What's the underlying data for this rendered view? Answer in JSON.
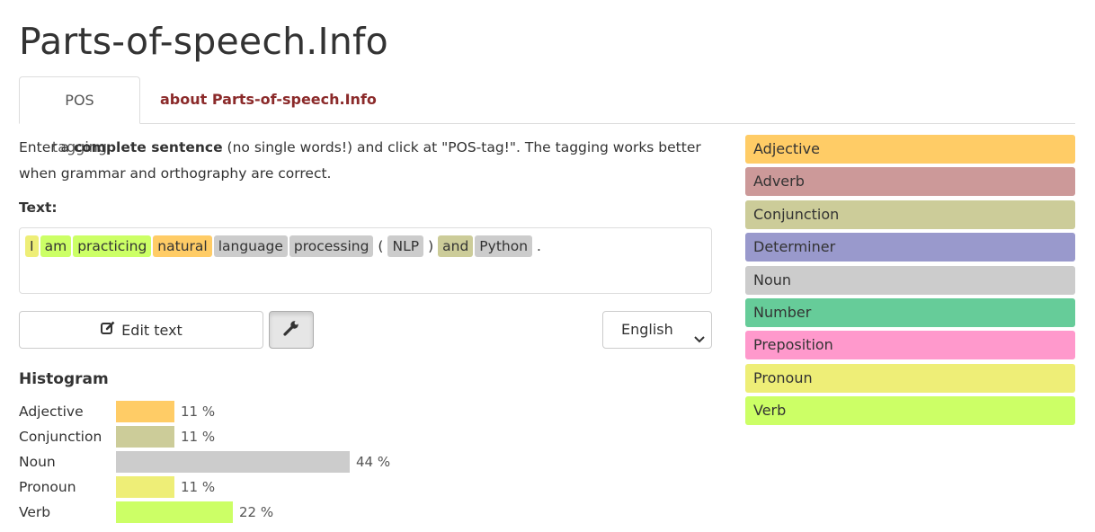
{
  "site": {
    "title": "Parts-of-speech.Info"
  },
  "tabs": [
    {
      "label": "POS tagging",
      "active": true
    },
    {
      "label": "about Parts-of-speech.Info",
      "active": false
    }
  ],
  "intro": {
    "part1": "Enter a ",
    "bold": "complete sentence",
    "part2": " (no single words!) and click at \"POS-tag!\". The tagging works better when grammar and orthography are correct."
  },
  "text_label": "Text:",
  "tokens": [
    {
      "text": "I",
      "pos": "Pronoun"
    },
    {
      "text": "am",
      "pos": "Verb"
    },
    {
      "text": "practicing",
      "pos": "Verb"
    },
    {
      "text": "natural",
      "pos": "Adjective"
    },
    {
      "text": "language",
      "pos": "Noun"
    },
    {
      "text": "processing",
      "pos": "Noun"
    },
    {
      "text": "(",
      "pos": null
    },
    {
      "text": "NLP",
      "pos": "Noun"
    },
    {
      "text": ")",
      "pos": null
    },
    {
      "text": "and",
      "pos": "Conjunction"
    },
    {
      "text": "Python",
      "pos": "Noun"
    },
    {
      "text": ".",
      "pos": null
    }
  ],
  "controls": {
    "edit_label": "Edit text",
    "edit_icon": "edit-icon",
    "settings_icon": "wrench-icon",
    "language_selected": "English"
  },
  "histogram": {
    "title": "Histogram",
    "rows": [
      {
        "label": "Adjective",
        "percent": 11,
        "value_text": "11 %"
      },
      {
        "label": "Conjunction",
        "percent": 11,
        "value_text": "11 %"
      },
      {
        "label": "Noun",
        "percent": 44,
        "value_text": "44 %"
      },
      {
        "label": "Pronoun",
        "percent": 11,
        "value_text": "11 %"
      },
      {
        "label": "Verb",
        "percent": 22,
        "value_text": "22 %"
      }
    ]
  },
  "legend": [
    {
      "label": "Adjective",
      "color": "#ffcc66"
    },
    {
      "label": "Adverb",
      "color": "#cc9999"
    },
    {
      "label": "Conjunction",
      "color": "#cccc99"
    },
    {
      "label": "Determiner",
      "color": "#9999cc"
    },
    {
      "label": "Noun",
      "color": "#cccccc"
    },
    {
      "label": "Number",
      "color": "#66cc99"
    },
    {
      "label": "Preposition",
      "color": "#ff99cc"
    },
    {
      "label": "Pronoun",
      "color": "#eeee77"
    },
    {
      "label": "Verb",
      "color": "#ccff66"
    }
  ],
  "colors": {
    "link": "#8b2a2a",
    "border": "#dddddd"
  }
}
